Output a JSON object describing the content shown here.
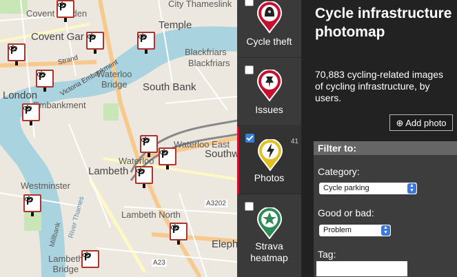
{
  "map": {
    "labels": {
      "city_thameslink": "City Thameslink",
      "covent_garden": "Covent Garden",
      "temple": "Temple",
      "blackfriars": "Blackfriars",
      "blackfriars2": "Blackfriars",
      "covent_gdn": "Covent Gar",
      "strand": "Strand",
      "embankment_road": "Victoria Embankment",
      "waterloo_bridge": "Waterloo\nBridge",
      "south_bank": "South Bank",
      "london": "London",
      "embankment": "Embankment",
      "waterloo_east": "Waterloo East",
      "southwark": "Southwark",
      "lambeth": "Lambeth",
      "westminster": "Westminster",
      "waterloo": "Waterloo",
      "lambeth_north": "Lambeth North",
      "river_thames": "River Thames",
      "a3202": "A3202",
      "a23": "A23",
      "lambeth_bridge": "Lambeth\nBridge",
      "elephant": "Elephant",
      "millbank": "Millbank"
    }
  },
  "layers": [
    {
      "label": "Cycle theft",
      "checked": false,
      "icon": "police-helmet-icon"
    },
    {
      "label": "Issues",
      "checked": false,
      "icon": "pushpin-icon"
    },
    {
      "label": "Photos",
      "checked": true,
      "icon": "camera-flash-icon",
      "count": "41"
    },
    {
      "label": "Strava heatmap",
      "checked": false,
      "icon": "strava-star-icon"
    }
  ],
  "panel": {
    "title": "Cycle infrastructure photomap",
    "subtitle": "70,883 cycling-related images of cycling infrastructure, by users.",
    "add_photo": "Add photo",
    "filter": {
      "heading": "Filter to:",
      "category_label": "Category:",
      "category_value": "Cycle parking",
      "good_bad_label": "Good or bad:",
      "good_bad_value": "Problem",
      "tag_label": "Tag:",
      "tag_value": ""
    }
  },
  "colors": {
    "accent_red": "#c8102e",
    "panel_bg": "#222222",
    "layer_bg": "#3a3a3a",
    "select_arrow": "#3a78e0"
  }
}
